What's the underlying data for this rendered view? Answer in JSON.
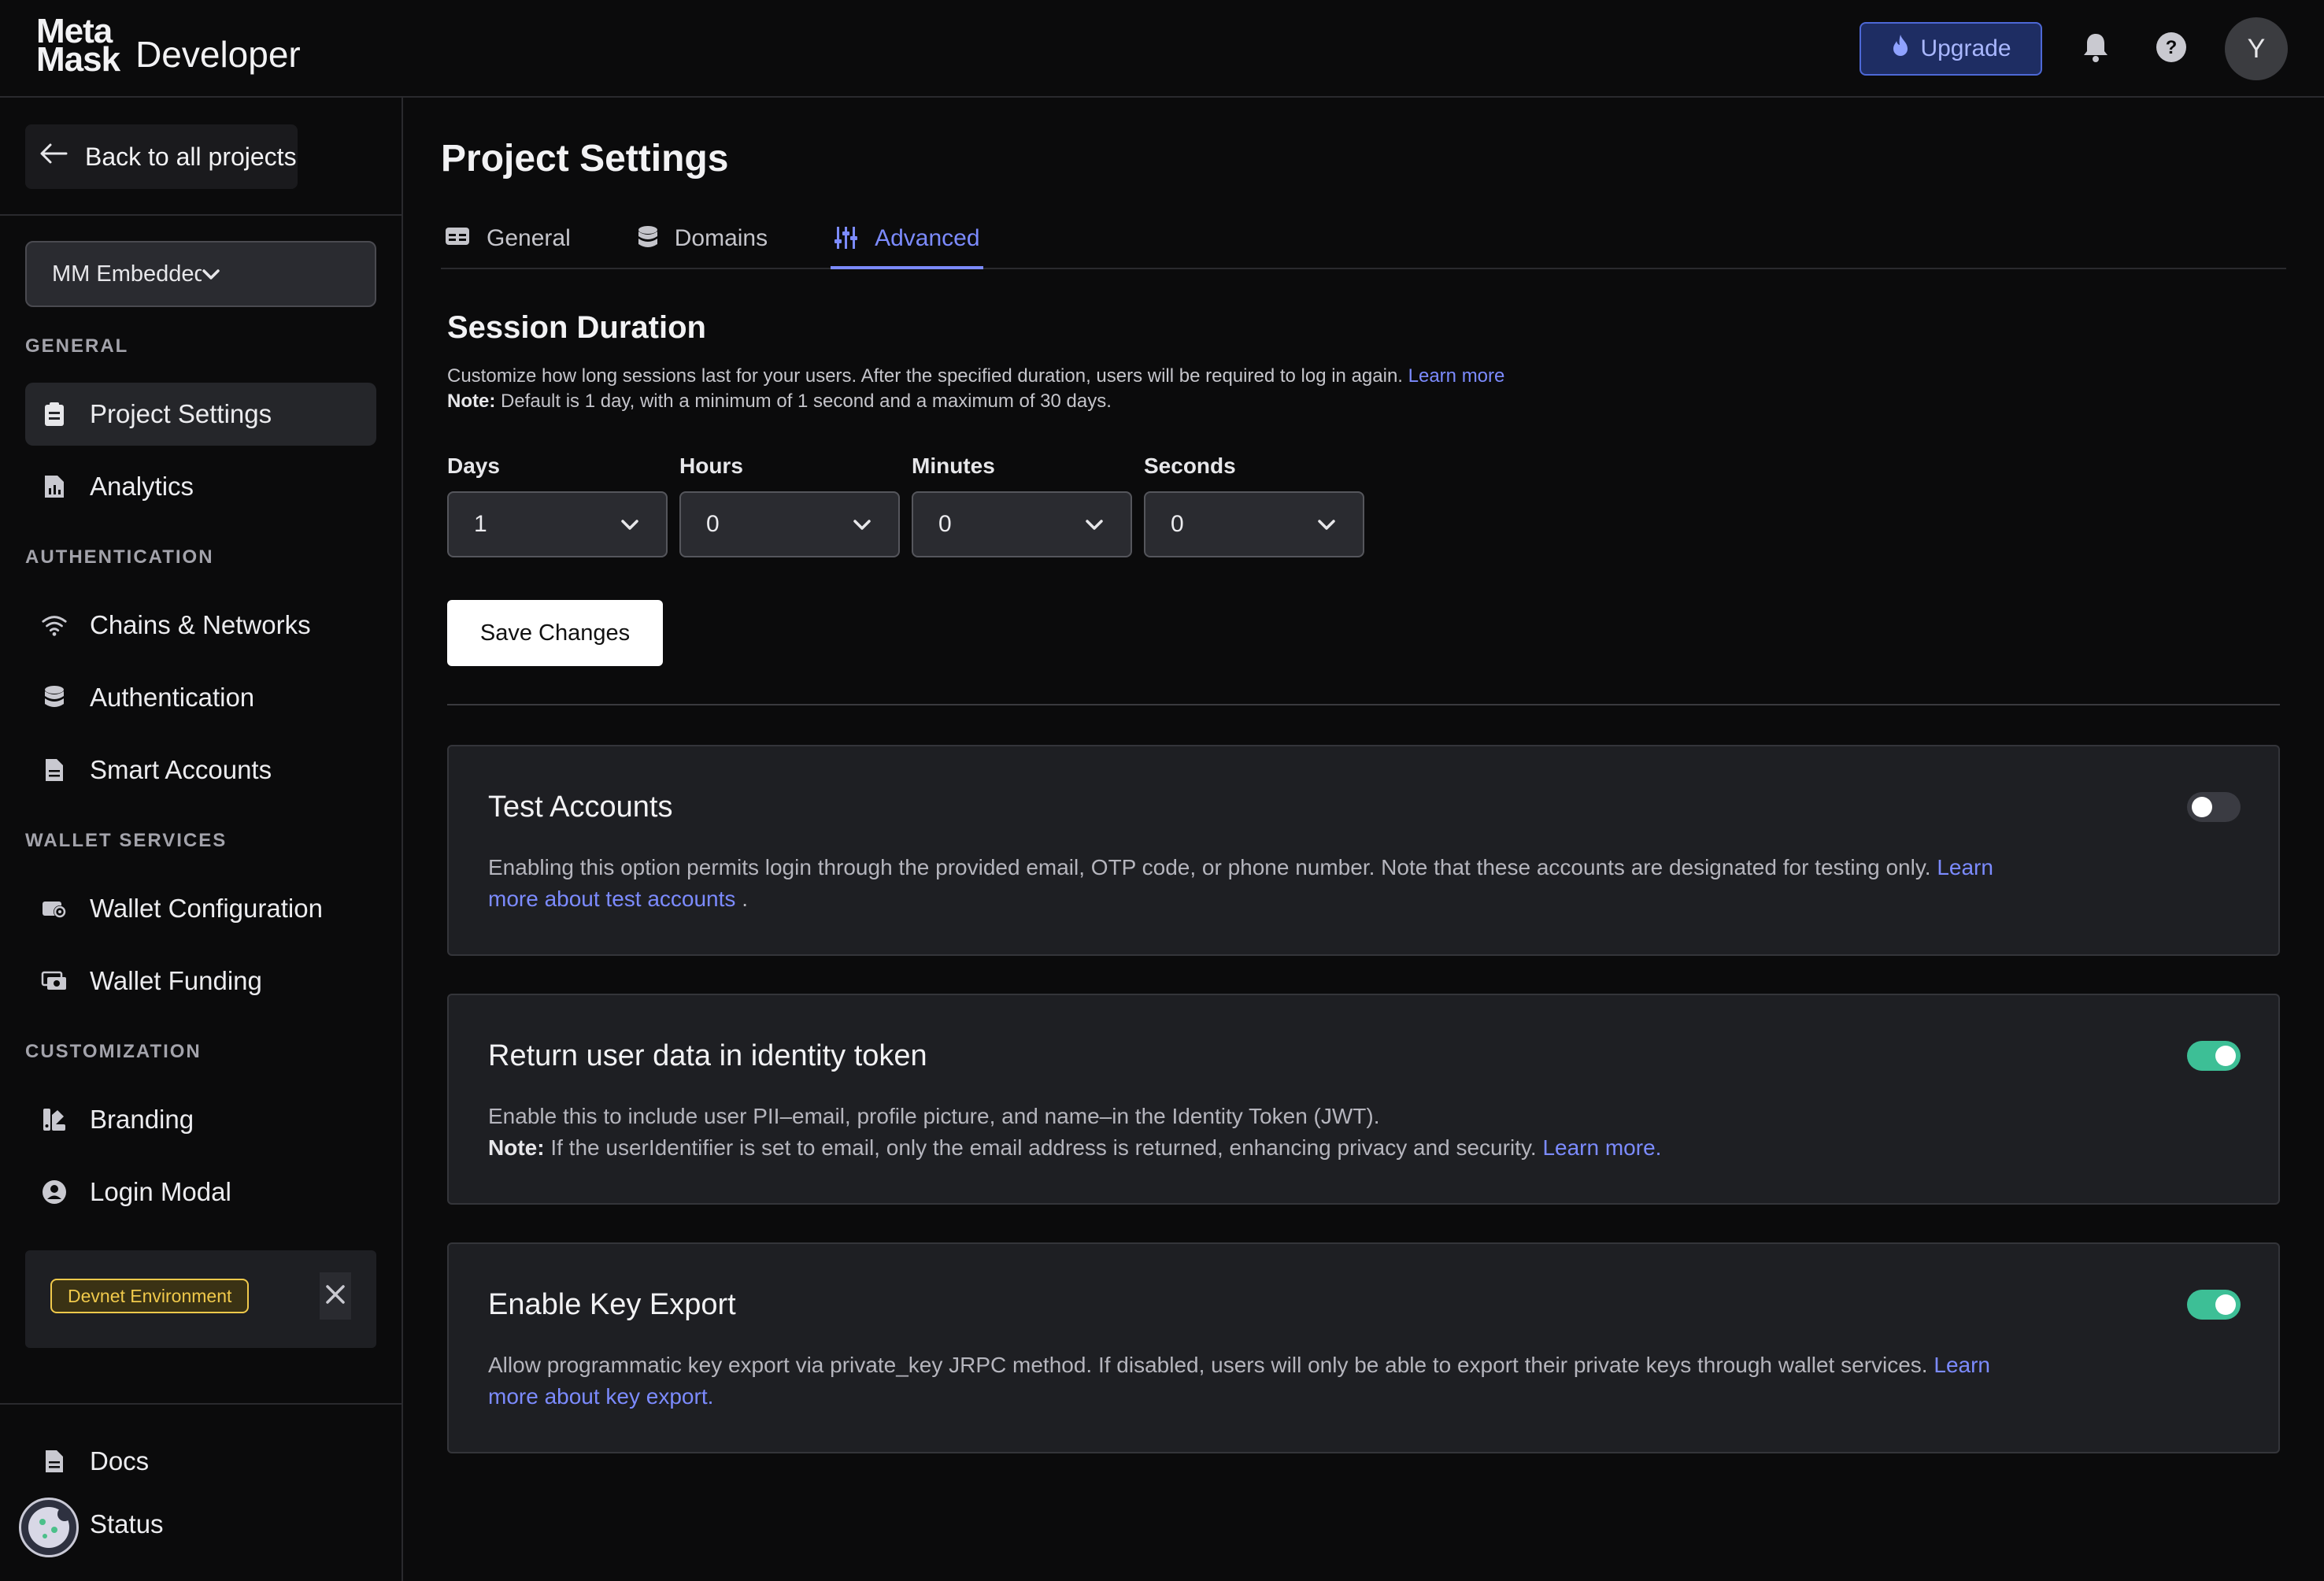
{
  "header": {
    "logo_line1": "Meta",
    "logo_line2": "Mask",
    "logo_product": "Developer",
    "upgrade_label": "Upgrade",
    "avatar_initial": "Y"
  },
  "sidebar": {
    "back_label": "Back to all projects",
    "project_select": "MM Embedded (sapphire",
    "sections": {
      "general": "GENERAL",
      "authentication": "AUTHENTICATION",
      "wallet_services": "WALLET SERVICES",
      "customization": "CUSTOMIZATION"
    },
    "items": {
      "project_settings": "Project Settings",
      "analytics": "Analytics",
      "chains_networks": "Chains & Networks",
      "authentication": "Authentication",
      "smart_accounts": "Smart Accounts",
      "wallet_configuration": "Wallet Configuration",
      "wallet_funding": "Wallet Funding",
      "branding": "Branding",
      "login_modal": "Login Modal",
      "docs": "Docs",
      "status": "Status"
    },
    "devnet_badge": "Devnet Environment"
  },
  "main": {
    "title": "Project Settings",
    "tabs": {
      "general": "General",
      "domains": "Domains",
      "advanced": "Advanced"
    },
    "session": {
      "title": "Session Duration",
      "desc": "Customize how long sessions last for your users. After the specified duration, users will be required to log in again.",
      "learn_more": "Learn more",
      "note_label": "Note:",
      "note_text": "Default is 1 day, with a minimum of 1 second and a maximum of 30 days.",
      "fields": {
        "days_label": "Days",
        "days_value": "1",
        "hours_label": "Hours",
        "hours_value": "0",
        "minutes_label": "Minutes",
        "minutes_value": "0",
        "seconds_label": "Seconds",
        "seconds_value": "0"
      },
      "save_label": "Save Changes"
    },
    "cards": {
      "test_accounts": {
        "title": "Test Accounts",
        "desc": "Enabling this option permits login through the provided email, OTP code, or phone number. Note that these accounts are designated for testing only.",
        "link": "Learn more about test accounts",
        "suffix": ".",
        "enabled": false
      },
      "identity_token": {
        "title": "Return user data in identity token",
        "desc": "Enable this to include user PII–email, profile picture, and name–in the Identity Token (JWT).",
        "note_label": "Note:",
        "note_text": "If the userIdentifier is set to email, only the email address is returned, enhancing privacy and security.",
        "link": "Learn more.",
        "enabled": true
      },
      "key_export": {
        "title": "Enable Key Export",
        "desc": "Allow programmatic key export via private_key JRPC method. If disabled, users will only be able to export their private keys through wallet services.",
        "link": "Learn more about key export.",
        "enabled": true
      }
    }
  },
  "colors": {
    "accent": "#7c8bff",
    "toggle_on": "#3dbf96",
    "devnet": "#f0c94b"
  }
}
